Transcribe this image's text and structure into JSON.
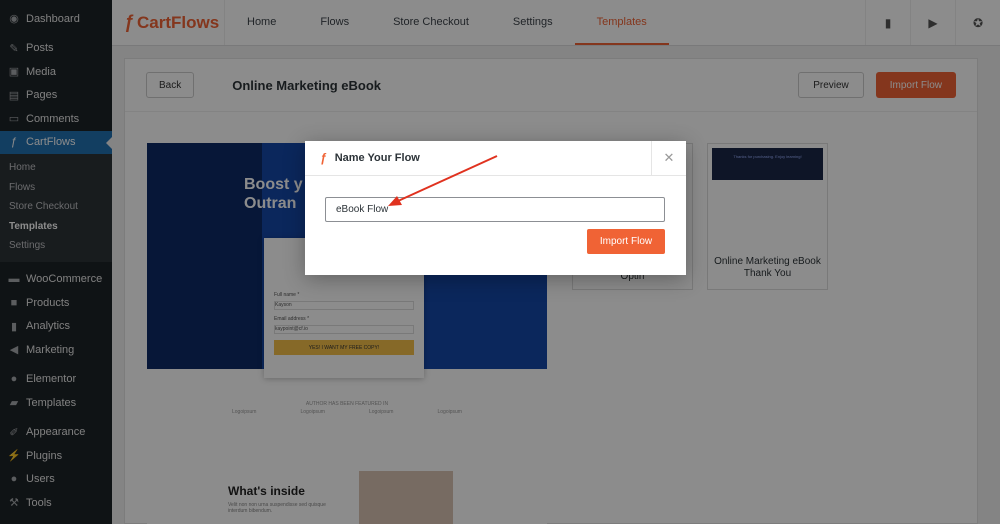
{
  "sidebar": {
    "items": [
      {
        "label": "Dashboard",
        "icon": "dashboard-icon"
      },
      {
        "label": "Posts",
        "icon": "pin-icon"
      },
      {
        "label": "Media",
        "icon": "media-icon"
      },
      {
        "label": "Pages",
        "icon": "pages-icon"
      },
      {
        "label": "Comments",
        "icon": "comment-icon"
      },
      {
        "label": "CartFlows",
        "icon": "cartflows-icon"
      },
      {
        "label": "WooCommerce",
        "icon": "woo-icon"
      },
      {
        "label": "Products",
        "icon": "products-icon"
      },
      {
        "label": "Analytics",
        "icon": "analytics-icon"
      },
      {
        "label": "Marketing",
        "icon": "megaphone-icon"
      },
      {
        "label": "Elementor",
        "icon": "elementor-icon"
      },
      {
        "label": "Templates",
        "icon": "folder-icon"
      },
      {
        "label": "Appearance",
        "icon": "brush-icon"
      },
      {
        "label": "Plugins",
        "icon": "plugin-icon"
      },
      {
        "label": "Users",
        "icon": "user-icon"
      },
      {
        "label": "Tools",
        "icon": "wrench-icon"
      }
    ],
    "sub": [
      "Home",
      "Flows",
      "Store Checkout",
      "Templates",
      "Settings"
    ]
  },
  "topbar": {
    "brand": "CartFlows",
    "nav": [
      "Home",
      "Flows",
      "Store Checkout",
      "Settings",
      "Templates"
    ]
  },
  "header": {
    "back": "Back",
    "title": "Online Marketing eBook",
    "preview": "Preview",
    "import": "Import Flow"
  },
  "preview": {
    "hero": "Boost y\nOutran",
    "form_labels": [
      "Full name *",
      "Email address *"
    ],
    "form_values": [
      "Kayson",
      "kaypoint@cf.io"
    ],
    "cta": "YES! I WANT MY FREE COPY!",
    "logos_caption": "AUTHOR HAS BEEN FEATURED IN",
    "logos": [
      "Logoipsum",
      "Logoipsum",
      "Logoipsum",
      "Logoipsum"
    ],
    "whats": "What's inside",
    "body": "Velit non non urna suspendisse sed quisque interdum bibendum."
  },
  "cards": {
    "b_label": "Optin",
    "c_label": "Online Marketing eBook Thank You",
    "c_thumb": "Thanks for purchasing. Enjoy learning!"
  },
  "modal": {
    "title": "Name Your Flow",
    "input_value": "eBook Flow",
    "button": "Import Flow"
  },
  "colors": {
    "accent": "#f06335",
    "sidebar_bg": "#1d2327",
    "active_blue": "#2271b1",
    "hero_blue": "#1547a8"
  }
}
